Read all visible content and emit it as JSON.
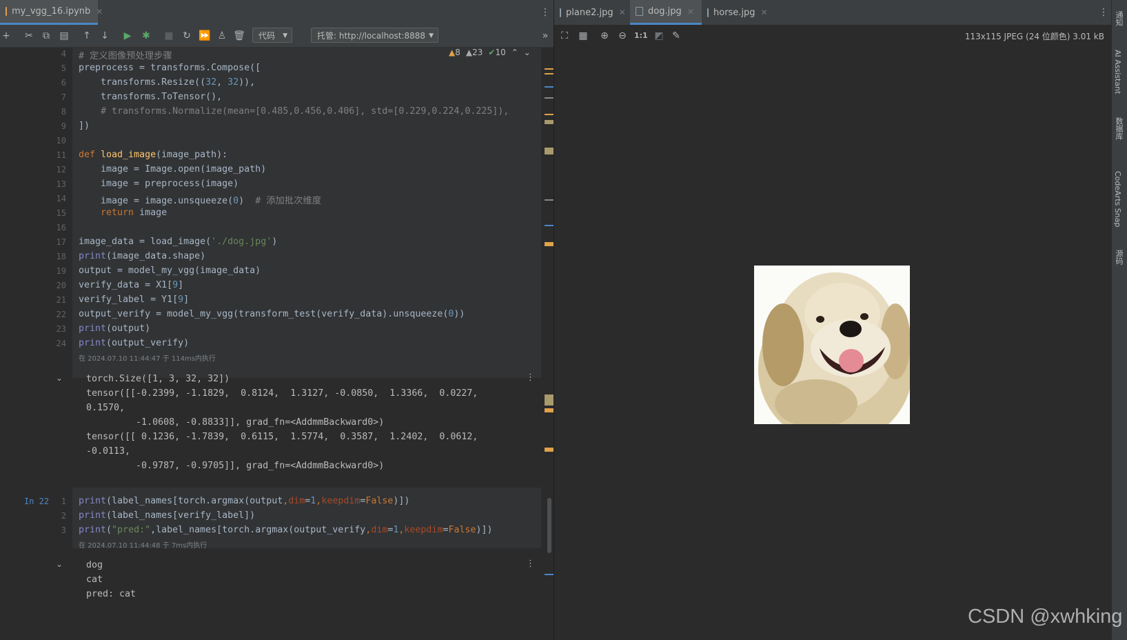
{
  "left_tab": {
    "label": "my_vgg_16.ipynb"
  },
  "toolbar": {
    "cell_type": "代码",
    "server": "托管: http://localhost:8888"
  },
  "inspections": {
    "warnings": "8",
    "weak_warnings": "23",
    "ok": "10"
  },
  "cell1": {
    "line_numbers": [
      "4",
      "5",
      "6",
      "7",
      "8",
      "9",
      "10",
      "11",
      "12",
      "13",
      "14",
      "15",
      "16",
      "17",
      "18",
      "19",
      "20",
      "21",
      "22",
      "23",
      "24"
    ],
    "exec_info": "在 2024.07.10 11:44:47 于 114ms内执行",
    "output": [
      "torch.Size([1, 3, 32, 32])",
      "tensor([[-0.2399, -1.1829,  0.8124,  1.3127, -0.0850,  1.3366,  0.0227,",
      "0.1570,",
      "         -1.0608, -0.8833]], grad_fn=<AddmmBackward0>)",
      "tensor([[ 0.1236, -1.7839,  0.6115,  1.5774,  0.3587,  1.2402,  0.0612,",
      "-0.0113,",
      "         -0.9787, -0.9705]], grad_fn=<AddmmBackward0>)"
    ]
  },
  "cell2": {
    "prompt": "In 22",
    "line_numbers": [
      "1",
      "2",
      "3"
    ],
    "exec_info": "在 2024.07.10 11:44:48 于 7ms内执行",
    "output": [
      "dog",
      "cat",
      "pred: cat"
    ]
  },
  "right_tabs": [
    {
      "label": "plane2.jpg",
      "active": false
    },
    {
      "label": "dog.jpg",
      "active": true
    },
    {
      "label": "horse.jpg",
      "active": false
    }
  ],
  "image_info": "113x115 JPEG (24 位颜色) 3.01 kB",
  "image_toolbar": {
    "actual_size": "1:1"
  },
  "side_tools": [
    "通知",
    "AI Assistant",
    "数据库",
    "CodeArts Snap",
    "源码"
  ],
  "watermark": "CSDN @xwhking",
  "colors": {
    "accent": "#4a88c7",
    "keyword": "#cc7832",
    "function": "#ffc66d",
    "number": "#6897bb",
    "string": "#6a8759"
  }
}
